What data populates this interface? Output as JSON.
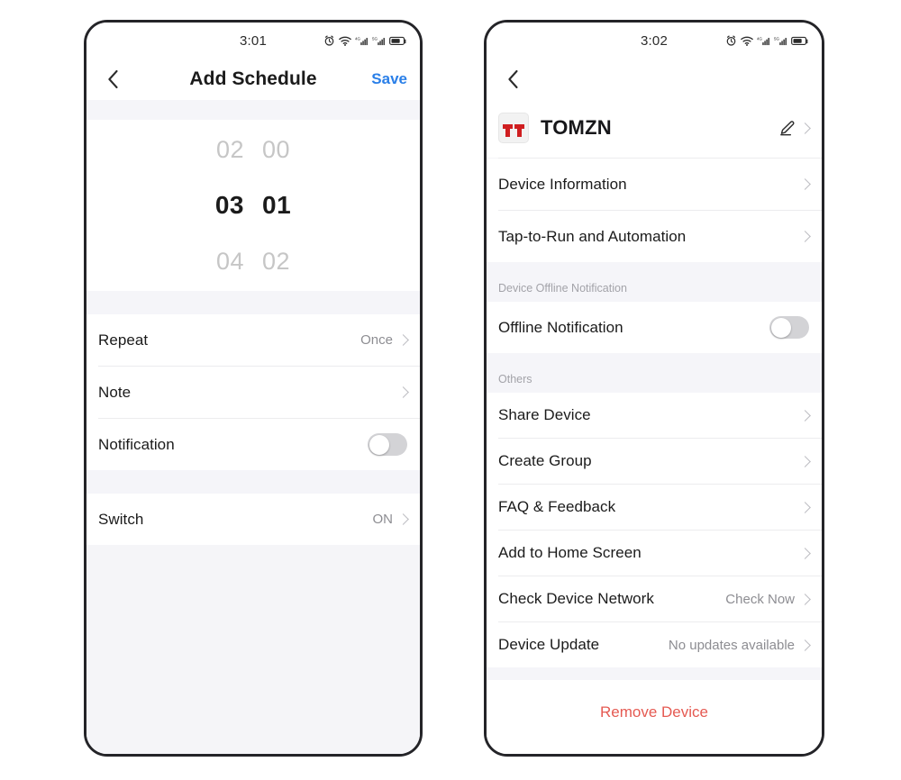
{
  "left_phone": {
    "status": {
      "time": "3:01",
      "icons": [
        "alarm-icon",
        "wifi-icon",
        "signal-4g-icon",
        "signal-5g-icon",
        "battery-icon"
      ]
    },
    "nav": {
      "back": "‹",
      "title": "Add Schedule",
      "action": "Save"
    },
    "picker": {
      "rows": [
        {
          "hour": "02",
          "minute": "00",
          "selected": false
        },
        {
          "hour": "03",
          "minute": "01",
          "selected": true
        },
        {
          "hour": "04",
          "minute": "02",
          "selected": false
        }
      ],
      "selected_hour": "03",
      "selected_minute": "01"
    },
    "settings": [
      {
        "label": "Repeat",
        "value": "Once",
        "control": "chevron"
      },
      {
        "label": "Note",
        "value": "",
        "control": "chevron"
      },
      {
        "label": "Notification",
        "value": "",
        "control": "toggle",
        "toggle_on": false
      }
    ],
    "switch_row": {
      "label": "Switch",
      "value": "ON",
      "control": "chevron"
    }
  },
  "right_phone": {
    "status": {
      "time": "3:02",
      "icons": [
        "alarm-icon",
        "wifi-icon",
        "signal-4g-icon",
        "signal-5g-icon",
        "battery-icon"
      ]
    },
    "nav": {
      "back": "‹"
    },
    "device": {
      "name": "TOMZN",
      "logo": "tomzn-logo",
      "edit": "edit-pencil-icon"
    },
    "group_top": [
      {
        "label": "Device Information",
        "value": "",
        "control": "chevron"
      },
      {
        "label": "Tap-to-Run and Automation",
        "value": "",
        "control": "chevron"
      }
    ],
    "section_offline": {
      "header": "Device Offline Notification",
      "rows": [
        {
          "label": "Offline Notification",
          "value": "",
          "control": "toggle",
          "toggle_on": false
        }
      ]
    },
    "section_others": {
      "header": "Others",
      "rows": [
        {
          "label": "Share Device",
          "value": "",
          "control": "chevron"
        },
        {
          "label": "Create Group",
          "value": "",
          "control": "chevron"
        },
        {
          "label": "FAQ & Feedback",
          "value": "",
          "control": "chevron"
        },
        {
          "label": "Add to Home Screen",
          "value": "",
          "control": "chevron"
        },
        {
          "label": "Check Device Network",
          "value": "Check Now",
          "control": "chevron"
        },
        {
          "label": "Device Update",
          "value": "No updates available",
          "control": "chevron"
        }
      ]
    },
    "remove": {
      "label": "Remove Device"
    }
  },
  "colors": {
    "accent_blue": "#2a7fe8",
    "danger_red": "#e55a52",
    "band_gray": "#f5f5f9",
    "page_gray": "#f5f5f8",
    "text_primary": "#1b1b1b",
    "text_muted": "#8d8d92",
    "logo_red": "#cf1e20"
  }
}
